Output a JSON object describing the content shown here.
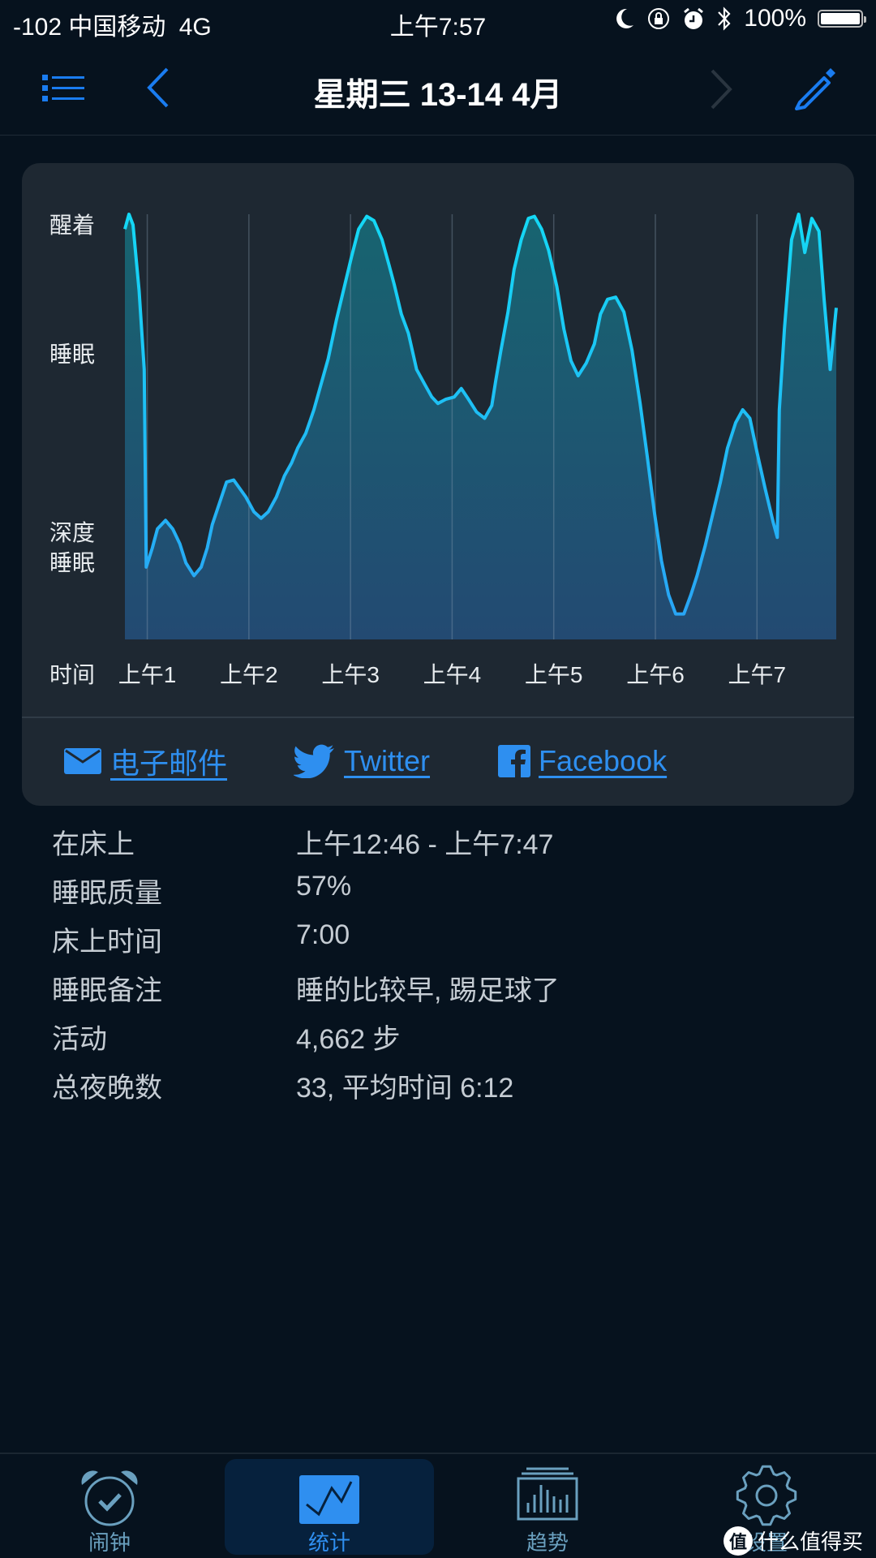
{
  "status_bar": {
    "signal": "-102",
    "carrier": "中国移动",
    "network": "4G",
    "time": "上午7:57",
    "battery": "100%",
    "icons": [
      "moon-icon",
      "rotation-lock-icon",
      "alarm-icon",
      "bluetooth-icon",
      "battery-icon"
    ]
  },
  "nav": {
    "title": "星期三 13-14 4月",
    "menu_icon": "list-icon",
    "prev_icon": "chevron-left-icon",
    "next_icon": "chevron-right-icon",
    "edit_icon": "pencil-icon"
  },
  "colors": {
    "background": "#06121e",
    "card": "#1e2832",
    "accent": "#2e8ff0",
    "curve_top": "#14d8f5",
    "curve_bottom": "#2aa2f5",
    "fill_top": "#176470",
    "fill_bottom": "#234a72",
    "tab_inactive": "#6aa0bf"
  },
  "chart_data": {
    "type": "area",
    "title": "",
    "xlabel": "时间",
    "ylabel": "",
    "y_levels": [
      {
        "label": "醒着",
        "value": 100
      },
      {
        "label": "睡眠",
        "value": 67
      },
      {
        "label": "深度\n睡眠",
        "value": 25
      }
    ],
    "y_level_labels": [
      "醒着",
      "睡眠",
      "深度",
      "睡眠"
    ],
    "ylim": [
      0,
      100
    ],
    "x_unit": "hours after midnight",
    "xlim": [
      0.78,
      7.78
    ],
    "x_ticks": [
      {
        "label": "上午1",
        "value": 1
      },
      {
        "label": "上午2",
        "value": 2
      },
      {
        "label": "上午3",
        "value": 3
      },
      {
        "label": "上午4",
        "value": 4
      },
      {
        "label": "上午5",
        "value": 5
      },
      {
        "label": "上午6",
        "value": 6
      },
      {
        "label": "上午7",
        "value": 7
      }
    ],
    "grid": "vertical-at-hours",
    "series": [
      {
        "name": "sleep-cycle",
        "points": [
          [
            0.78,
            96.5
          ],
          [
            0.82,
            100
          ],
          [
            0.86,
            97.5
          ],
          [
            0.92,
            82
          ],
          [
            0.97,
            63.5
          ],
          [
            0.99,
            17
          ],
          [
            1.05,
            21.5
          ],
          [
            1.1,
            26
          ],
          [
            1.18,
            28
          ],
          [
            1.25,
            26
          ],
          [
            1.32,
            22.5
          ],
          [
            1.38,
            18
          ],
          [
            1.46,
            15
          ],
          [
            1.53,
            17
          ],
          [
            1.59,
            21.5
          ],
          [
            1.64,
            27
          ],
          [
            1.71,
            32
          ],
          [
            1.78,
            37
          ],
          [
            1.85,
            37.5
          ],
          [
            1.91,
            35.5
          ],
          [
            1.97,
            33.5
          ],
          [
            2.05,
            30
          ],
          [
            2.12,
            28.5
          ],
          [
            2.19,
            30
          ],
          [
            2.27,
            33.5
          ],
          [
            2.35,
            38.5
          ],
          [
            2.42,
            41.5
          ],
          [
            2.48,
            45
          ],
          [
            2.56,
            48.5
          ],
          [
            2.64,
            54
          ],
          [
            2.71,
            60
          ],
          [
            2.78,
            66
          ],
          [
            2.86,
            75
          ],
          [
            2.94,
            83
          ],
          [
            3.01,
            90
          ],
          [
            3.08,
            96.5
          ],
          [
            3.16,
            99.5
          ],
          [
            3.23,
            98.5
          ],
          [
            3.31,
            94
          ],
          [
            3.38,
            88
          ],
          [
            3.43,
            83.5
          ],
          [
            3.5,
            76.5
          ],
          [
            3.57,
            72
          ],
          [
            3.65,
            63.5
          ],
          [
            3.73,
            60
          ],
          [
            3.8,
            57
          ],
          [
            3.86,
            55.5
          ],
          [
            3.94,
            56.5
          ],
          [
            4.02,
            57
          ],
          [
            4.09,
            59
          ],
          [
            4.16,
            56.5
          ],
          [
            4.24,
            53.5
          ],
          [
            4.32,
            52
          ],
          [
            4.39,
            55
          ],
          [
            4.43,
            61
          ],
          [
            4.48,
            68
          ],
          [
            4.55,
            77
          ],
          [
            4.61,
            87
          ],
          [
            4.68,
            94
          ],
          [
            4.75,
            99
          ],
          [
            4.81,
            99.5
          ],
          [
            4.88,
            96.5
          ],
          [
            4.95,
            91.5
          ],
          [
            5.03,
            83
          ],
          [
            5.1,
            73
          ],
          [
            5.17,
            65.5
          ],
          [
            5.24,
            62
          ],
          [
            5.32,
            65
          ],
          [
            5.4,
            69.5
          ],
          [
            5.46,
            76.5
          ],
          [
            5.53,
            80
          ],
          [
            5.61,
            80.5
          ],
          [
            5.69,
            77
          ],
          [
            5.77,
            68
          ],
          [
            5.85,
            55.5
          ],
          [
            5.92,
            43
          ],
          [
            5.99,
            30
          ],
          [
            6.06,
            18.5
          ],
          [
            6.13,
            10.5
          ],
          [
            6.2,
            6
          ],
          [
            6.28,
            6
          ],
          [
            6.35,
            10.5
          ],
          [
            6.41,
            15
          ],
          [
            6.49,
            22
          ],
          [
            6.57,
            30
          ],
          [
            6.64,
            37
          ],
          [
            6.71,
            45
          ],
          [
            6.79,
            51
          ],
          [
            6.86,
            54
          ],
          [
            6.93,
            52
          ],
          [
            7.0,
            44
          ],
          [
            7.08,
            35.5
          ],
          [
            7.16,
            27.5
          ],
          [
            7.2,
            24
          ],
          [
            7.22,
            54
          ],
          [
            7.27,
            73
          ],
          [
            7.34,
            94
          ],
          [
            7.41,
            100
          ],
          [
            7.47,
            91
          ],
          [
            7.54,
            99
          ],
          [
            7.61,
            96
          ],
          [
            7.66,
            80
          ],
          [
            7.72,
            63.5
          ],
          [
            7.78,
            78
          ]
        ]
      }
    ]
  },
  "share": [
    {
      "label": "电子邮件",
      "icon": "envelope-icon"
    },
    {
      "label": "Twitter",
      "icon": "twitter-bird-icon"
    },
    {
      "label": "Facebook",
      "icon": "facebook-icon"
    }
  ],
  "stats": [
    {
      "label": "在床上",
      "value": "上午12:46 - 上午7:47"
    },
    {
      "label": "睡眠质量",
      "value": "57%"
    },
    {
      "label": "床上时间",
      "value": "7:00"
    },
    {
      "label": "睡眠备注",
      "value": "睡的比较早, 踢足球了"
    },
    {
      "label": "活动",
      "value": "4,662 步"
    },
    {
      "label": "总夜晚数",
      "value": "33, 平均时间 6:12"
    }
  ],
  "tabs": [
    {
      "label": "闹钟",
      "icon": "alarm-clock-icon",
      "selected": false
    },
    {
      "label": "统计",
      "icon": "statistics-chart-icon",
      "selected": true
    },
    {
      "label": "趋势",
      "icon": "trends-bar-chart-icon",
      "selected": false
    },
    {
      "label": "设置",
      "icon": "gear-icon",
      "selected": false
    }
  ],
  "watermark": {
    "badge": "值",
    "text": "什么值得买"
  }
}
